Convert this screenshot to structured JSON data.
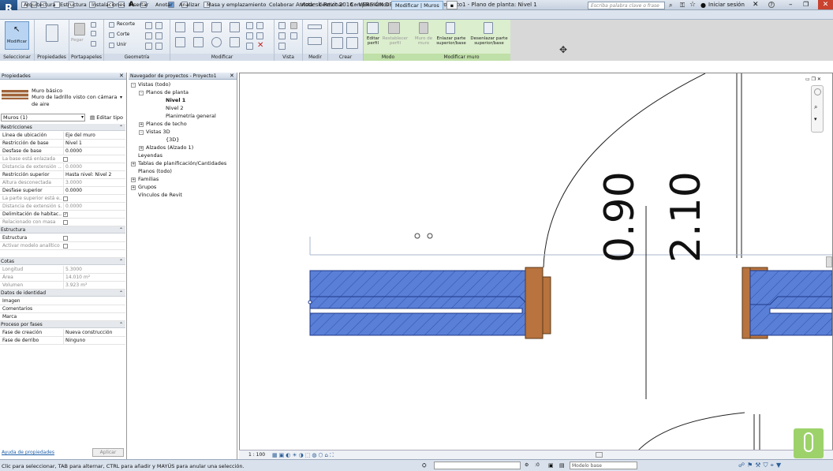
{
  "app": {
    "title": "Autodesk Revit 2016 - VERSIÓN DEL ESTUDIANTE -    Proyecto1 - Plano de planta: Nivel 1",
    "logo_letter": "R",
    "search_placeholder": "Escriba palabra clave o frase",
    "signin": "Iniciar sesión",
    "help": "?"
  },
  "tabs": [
    "Arquitectura",
    "Estructura",
    "Instalaciones",
    "Insertar",
    "Anotar",
    "Analizar",
    "Masa y emplazamiento",
    "Colaborar",
    "Vista",
    "Gestionar",
    "Complementos",
    "Modificar | Muros"
  ],
  "ribbon": {
    "groups": [
      "Seleccionar",
      "Propiedades",
      "Portapapeles",
      "Geometría",
      "Modificar",
      "Vista",
      "Medir",
      "Crear",
      "Modo",
      "Modificar muro"
    ],
    "modify_button": "Modificar",
    "paste": "Pegar",
    "recorte": "Recorte",
    "corte": "Corte",
    "unir": "Unir",
    "editar_perfil": "Editar perfil",
    "restablecer_perfil": "Restablecer perfil",
    "muro_de_muro": "Muro de muro",
    "enlazar": "Enlazar parte superior/base",
    "desenlazar": "Desenlazar parte superior/base"
  },
  "properties": {
    "header": "Propiedades",
    "type_family": "Muro básico",
    "type_name": "Muro de ladrillo visto con cámara de aire",
    "filter": "Muros (1)",
    "edit_type": "Editar tipo",
    "help_link": "Ayuda de propiedades",
    "apply": "Aplicar",
    "rows": [
      {
        "kind": "cat",
        "label": "Restricciones"
      },
      {
        "kind": "row",
        "k": "Línea de ubicación",
        "v": "Eje del muro"
      },
      {
        "kind": "row",
        "k": "Restricción de base",
        "v": "Nivel 1"
      },
      {
        "kind": "row",
        "k": "Desfase de base",
        "v": "0.0000"
      },
      {
        "kind": "chk",
        "k": "La base está enlazada",
        "dim": true
      },
      {
        "kind": "row",
        "k": "Distancia de extensión ...",
        "v": "0.0000",
        "dim": true
      },
      {
        "kind": "row",
        "k": "Restricción superior",
        "v": "Hasta nivel: Nivel 2"
      },
      {
        "kind": "row",
        "k": "Altura desconectada",
        "v": "3.0000",
        "dim": true
      },
      {
        "kind": "row",
        "k": "Desfase superior",
        "v": "0.0000"
      },
      {
        "kind": "chk",
        "k": "La parte superior está e...",
        "dim": true
      },
      {
        "kind": "row",
        "k": "Distancia de extensión s...",
        "v": "0.0000",
        "dim": true
      },
      {
        "kind": "chkon",
        "k": "Delimitación de habitac..."
      },
      {
        "kind": "chk",
        "k": "Relacionado con masa",
        "dim": true
      },
      {
        "kind": "cat",
        "label": "Estructura"
      },
      {
        "kind": "chk",
        "k": "Estructura"
      },
      {
        "kind": "chk",
        "k": "Activar modelo analítico",
        "dim": true
      },
      {
        "kind": "blank"
      },
      {
        "kind": "cat",
        "label": "Cotas"
      },
      {
        "kind": "row",
        "k": "Longitud",
        "v": "5.3000",
        "dim": true
      },
      {
        "kind": "row",
        "k": "Área",
        "v": "14.010 m²",
        "dim": true
      },
      {
        "kind": "row",
        "k": "Volumen",
        "v": "3.923 m³",
        "dim": true
      },
      {
        "kind": "cat",
        "label": "Datos de identidad"
      },
      {
        "kind": "row",
        "k": "Imagen",
        "v": ""
      },
      {
        "kind": "row",
        "k": "Comentarios",
        "v": ""
      },
      {
        "kind": "row",
        "k": "Marca",
        "v": ""
      },
      {
        "kind": "cat",
        "label": "Proceso por fases"
      },
      {
        "kind": "row",
        "k": "Fase de creación",
        "v": "Nueva construcción"
      },
      {
        "kind": "row",
        "k": "Fase de derribo",
        "v": "Ninguno"
      }
    ]
  },
  "browser": {
    "header": "Navegador de proyectos - Proyecto1",
    "nodes": [
      {
        "label": "Vistas (todo)",
        "indent": 0,
        "exp": "-"
      },
      {
        "label": "Planos de planta",
        "indent": 1,
        "exp": "-"
      },
      {
        "label": "Nivel 1",
        "indent": 2,
        "bold": true
      },
      {
        "label": "Nivel 2",
        "indent": 2
      },
      {
        "label": "Planimetría general",
        "indent": 2
      },
      {
        "label": "Planos de techo",
        "indent": 1,
        "exp": "+"
      },
      {
        "label": "Vistas 3D",
        "indent": 1,
        "exp": "-"
      },
      {
        "label": "{3D}",
        "indent": 2
      },
      {
        "label": "Alzados (Alzado 1)",
        "indent": 1,
        "exp": "+"
      },
      {
        "label": "Leyendas",
        "indent": 0
      },
      {
        "label": "Tablas de planificación/Cantidades",
        "indent": 0,
        "exp": "+"
      },
      {
        "label": "Planos (todo)",
        "indent": 0
      },
      {
        "label": "Familias",
        "indent": 0,
        "exp": "+"
      },
      {
        "label": "Grupos",
        "indent": 0,
        "exp": "+"
      },
      {
        "label": "Vínculos de Revit",
        "indent": 0
      }
    ]
  },
  "view": {
    "dim1": "0.90",
    "dim2": "2.10",
    "scale": "1 : 100"
  },
  "status": {
    "text": "Clic para seleccionar, TAB para alternar, CTRL para añadir y MAYÚS para anular una selección.",
    "model": "Modelo base",
    "zero": ":0"
  },
  "colors": {
    "wall": "#5a7fd6",
    "wall_hatch": "#2f4fa8",
    "frame": "#b8733e",
    "accent": "#2d5f99"
  }
}
